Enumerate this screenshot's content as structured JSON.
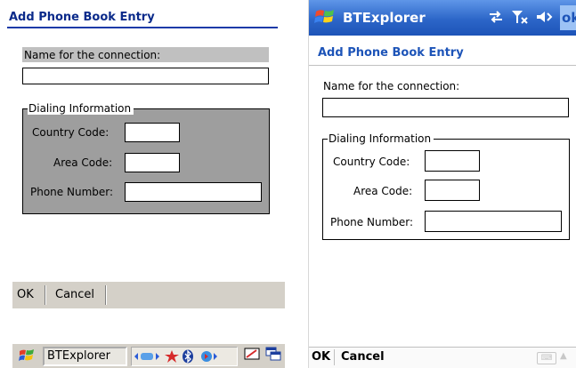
{
  "left": {
    "title": "Add Phone Book Entry",
    "name_label": "Name for the connection:",
    "name_value": "",
    "group_legend": "Dialing Information",
    "country_label": "Country Code:",
    "area_label": "Area Code:",
    "phone_label": "Phone Number:",
    "ok_label": "OK",
    "cancel_label": "Cancel",
    "taskbar_app": "BTExplorer",
    "start_icon": "windows-flag-icon",
    "tray_icons": [
      "network-icon",
      "sync-icon",
      "bluetooth-icon",
      "volume-icon"
    ]
  },
  "right": {
    "app_title": "BTExplorer",
    "ok_label": "ok",
    "title": "Add Phone Book Entry",
    "name_label": "Name for the connection:",
    "name_value": "",
    "group_legend": "Dialing Information",
    "country_label": "Country Code:",
    "area_label": "Area Code:",
    "phone_label": "Phone Number:",
    "ok_softkey": "OK",
    "cancel_softkey": "Cancel"
  },
  "colors": {
    "left_title": "#0a2a8a",
    "left_group_bg": "#9e9e9e",
    "wm_bar": "#2c66c8",
    "wm_title": "#1d54b8"
  }
}
